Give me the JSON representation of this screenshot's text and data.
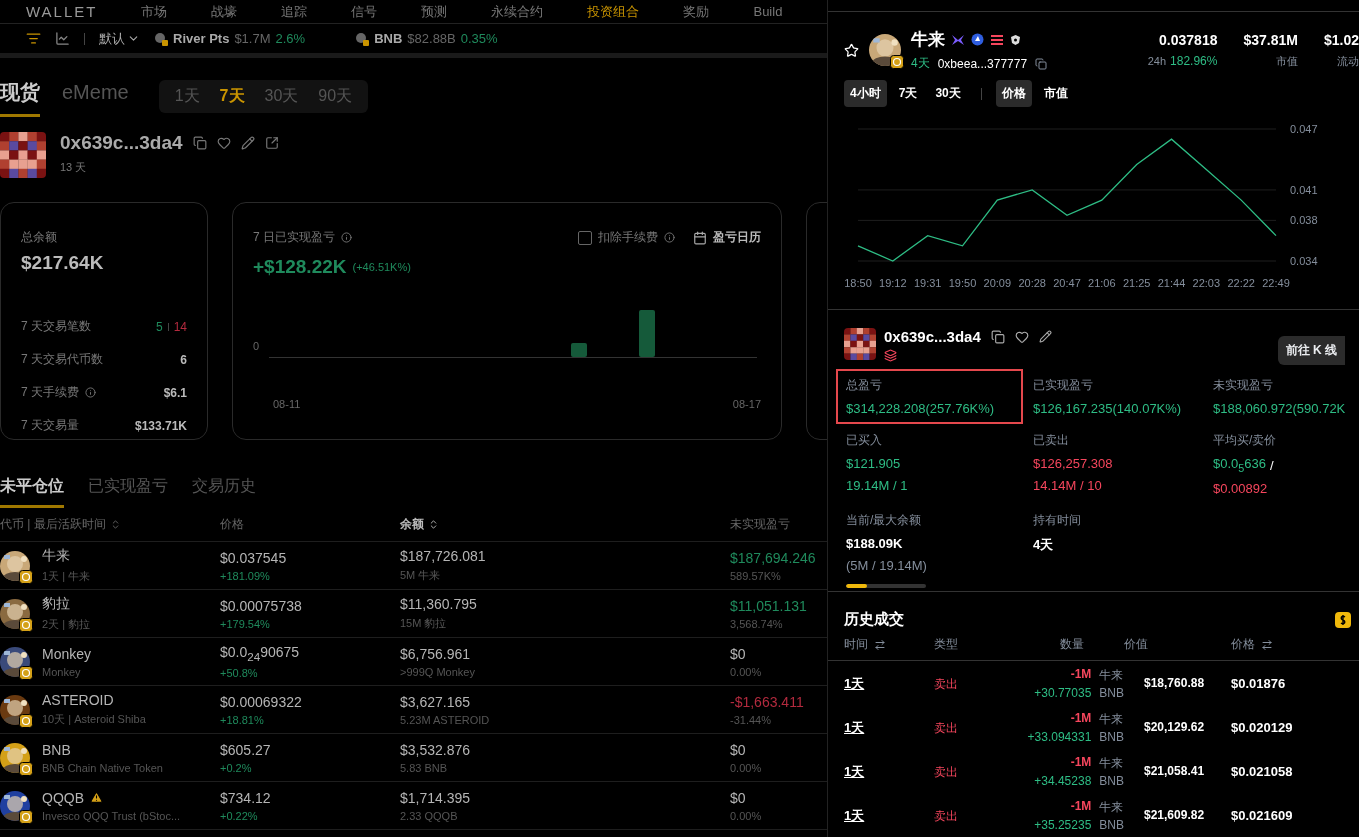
{
  "nav": {
    "logo": "WALLET",
    "items": [
      {
        "label": "市场",
        "selected": false
      },
      {
        "label": "战壕",
        "selected": false
      },
      {
        "label": "追踪",
        "selected": false
      },
      {
        "label": "信号",
        "selected": false
      },
      {
        "label": "预测",
        "selected": false
      },
      {
        "label": "永续合约",
        "selected": false
      },
      {
        "label": "投资组合",
        "selected": true
      },
      {
        "label": "奖励",
        "selected": false
      },
      {
        "label": "Build",
        "selected": false
      }
    ]
  },
  "ticker_bar": {
    "sort": "默认",
    "tickers": [
      {
        "name": "River Pts",
        "value": "$1.7M",
        "change": "2.6%"
      },
      {
        "name": "BNB",
        "value": "$82.88B",
        "change": "0.35%"
      }
    ]
  },
  "portfolio": {
    "tabs": [
      {
        "label": "现货",
        "selected": true
      },
      {
        "label": "eMeme",
        "selected": false
      }
    ],
    "periods": [
      {
        "label": "1天",
        "selected": false
      },
      {
        "label": "7天",
        "selected": true
      },
      {
        "label": "30天",
        "selected": false
      },
      {
        "label": "90天",
        "selected": false
      }
    ],
    "wallet": {
      "address": "0x639c...3da4",
      "age": "13 天"
    },
    "balance_card": {
      "label": "总余额",
      "value": "$217.64K",
      "stats": [
        {
          "label": "7 天交易笔数",
          "kind": "split",
          "buys": "5",
          "sells": "14"
        },
        {
          "label": "7 天交易代币数",
          "kind": "plain",
          "value": "6"
        },
        {
          "label": "7 天手续费",
          "kind": "info",
          "value": "$6.1"
        },
        {
          "label": "7 天交易量",
          "kind": "plain",
          "value": "$133.71K"
        }
      ]
    },
    "pnl_card": {
      "title": "7 日已实现盈亏",
      "fee_toggle": {
        "label": "扣除手续费",
        "checked": false
      },
      "calendar": "盈亏日历",
      "value": "+$128.22K",
      "percent": "(+46.51K%)",
      "y_label": "0",
      "x_labels": [
        "08-11",
        "08-17"
      ]
    },
    "positions": {
      "tabs": [
        {
          "label": "未平仓位",
          "selected": true
        },
        {
          "label": "已实现盈亏",
          "selected": false
        },
        {
          "label": "交易历史",
          "selected": false
        }
      ],
      "columns": [
        "代币 | 最后活跃时间",
        "价格",
        "余额",
        "未实现盈亏"
      ],
      "rows": [
        {
          "name": "牛来",
          "sub": "1天 | 牛来",
          "price": "$0.037545",
          "change": "+181.09%",
          "balance": "$187,726.081",
          "amount": "5M 牛来",
          "pnl": "$187,694.246",
          "pnl_percent": "589.57K%",
          "color": "#1f8a5c",
          "warning": false
        },
        {
          "name": "豹拉",
          "sub": "2天 | 豹拉",
          "price": "$0.00075738",
          "change": "+179.54%",
          "balance": "$11,360.795",
          "amount": "15M 豹拉",
          "pnl": "$11,051.131",
          "pnl_percent": "3,568.74%",
          "color": "#1f8a5c",
          "warning": false
        },
        {
          "name": "Monkey",
          "sub": "Monkey",
          "price": "$0.0$_{24}$90675",
          "change": "+50.8%",
          "balance": "$6,756.961",
          "amount": ">999Q Monkey",
          "pnl": "$0",
          "pnl_percent": "0.00%",
          "color": "#b5b5b5",
          "warning": false
        },
        {
          "name": "ASTEROID",
          "sub": "10天 | Asteroid Shiba",
          "price": "$0.00069322",
          "change": "+18.81%",
          "balance": "$3,627.165",
          "amount": "5.23M ASTEROID",
          "pnl": "-$1,663.411",
          "pnl_percent": "-31.44%",
          "color": "#b32a3e",
          "warning": false
        },
        {
          "name": "BNB",
          "sub": "BNB Chain Native Token",
          "price": "$605.27",
          "change": "+0.2%",
          "balance": "$3,532.876",
          "amount": "5.83 BNB",
          "pnl": "$0",
          "pnl_percent": "0.00%",
          "color": "#b5b5b5",
          "warning": false
        },
        {
          "name": "QQQB",
          "sub": "Invesco QQQ Trust (bStoc...",
          "price": "$734.12",
          "change": "+0.22%",
          "balance": "$1,714.395",
          "amount": "2.33 QQQB",
          "pnl": "$0",
          "pnl_percent": "0.00%",
          "color": "#b5b5b5",
          "warning": true
        }
      ]
    }
  },
  "token": {
    "name": "牛来",
    "age": "4天",
    "address": "0xbeea...377777",
    "stats": [
      {
        "value": "0.037818",
        "label": "24h",
        "change": "182.96%"
      },
      {
        "value": "$37.81M",
        "label": "市值"
      },
      {
        "value": "$1.02",
        "label": "流动"
      }
    ],
    "intervals": [
      {
        "label": "4小时",
        "selected": true
      },
      {
        "label": "7天",
        "selected": false
      },
      {
        "label": "30天",
        "selected": false
      }
    ],
    "modes": [
      {
        "label": "价格",
        "selected": true
      },
      {
        "label": "市值",
        "selected": false
      }
    ],
    "chart_data": {
      "type": "line",
      "categories": [
        "18:50",
        "19:12",
        "19:31",
        "19:50",
        "20:09",
        "20:28",
        "20:47",
        "21:06",
        "21:25",
        "21:44",
        "22:03",
        "22:22",
        "22:49"
      ],
      "ylim": [
        0.034,
        0.047
      ],
      "grid": true,
      "yticks": [
        {
          "value": 0.034,
          "label": "0.034"
        },
        {
          "value": 0.038,
          "label": "0.038"
        },
        {
          "value": 0.041,
          "label": "0.041"
        },
        {
          "value": 0.047,
          "label": "0.047"
        }
      ],
      "series": [
        {
          "color": "#2ebd85",
          "values": [
            0.0355,
            0.034,
            0.0365,
            0.0355,
            0.04,
            0.041,
            0.0385,
            0.04,
            0.0435,
            0.046,
            0.043,
            0.04,
            0.0365
          ]
        }
      ]
    }
  },
  "holder": {
    "address": "0x639c...3da4",
    "button": "前往 K 线",
    "stats": [
      {
        "label": "总盈亏",
        "lines": [
          "$314,228.208(257.76K%)"
        ],
        "color": "#2ebd85",
        "highlighted": true
      },
      {
        "label": "已实现盈亏",
        "lines": [
          "$126,167.235(140.07K%)"
        ],
        "color": "#2ebd85",
        "highlighted": false
      },
      {
        "label": "未实现盈亏",
        "lines": [
          "$188,060.972(590.72K"
        ],
        "color": "#2ebd85",
        "highlighted": false
      },
      {
        "label": "已买入",
        "lines": [
          "$121.905",
          "19.14M / 1"
        ],
        "color": "#2ebd85",
        "highlighted": false
      },
      {
        "label": "已卖出",
        "lines": [
          "$126,257.308",
          "14.14M / 10"
        ],
        "color": "#f6465d",
        "highlighted": false
      },
      {
        "label": "平均买/卖价",
        "kind": "avg",
        "buy": "$0.0$_{5}$636",
        "sep": "/",
        "sell": "$0.00892",
        "highlighted": false
      }
    ],
    "balance": {
      "label": "当前/最大余额",
      "value": "$188.09K",
      "detail": "(5M / 19.14M)",
      "level": 0.26
    },
    "holding": {
      "label": "持有时间",
      "value": "4天"
    }
  },
  "history": {
    "title": "历史成交",
    "columns": [
      "时间",
      "类型",
      "数量",
      "价值",
      "价格"
    ],
    "rows": [
      {
        "time": "1天",
        "type": "卖出",
        "out": "-1M",
        "out_token": "牛来",
        "in": "+30.77035",
        "in_token": "BNB",
        "value": "$18,760.88",
        "price": "$0.01876"
      },
      {
        "time": "1天",
        "type": "卖出",
        "out": "-1M",
        "out_token": "牛来",
        "in": "+33.094331",
        "in_token": "BNB",
        "value": "$20,129.62",
        "price": "$0.020129"
      },
      {
        "time": "1天",
        "type": "卖出",
        "out": "-1M",
        "out_token": "牛来",
        "in": "+34.45238",
        "in_token": "BNB",
        "value": "$21,058.41",
        "price": "$0.021058"
      },
      {
        "time": "1天",
        "type": "卖出",
        "out": "-1M",
        "out_token": "牛来",
        "in": "+35.25235",
        "in_token": "BNB",
        "value": "$21,609.82",
        "price": "$0.021609"
      }
    ]
  }
}
